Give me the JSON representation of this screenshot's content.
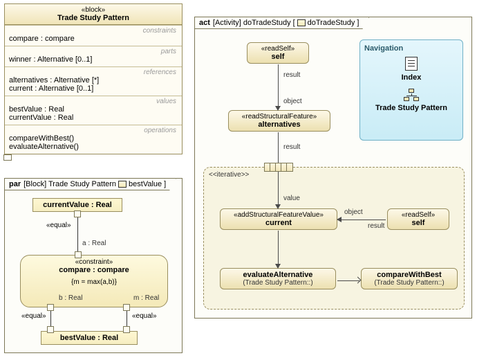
{
  "block": {
    "stereo": "«block»",
    "name": "Trade Study Pattern",
    "sections": {
      "constraints": {
        "label": "constraints",
        "items": [
          "compare : compare"
        ]
      },
      "parts": {
        "label": "parts",
        "items": [
          "winner : Alternative [0..1]"
        ]
      },
      "references": {
        "label": "references",
        "items": [
          "alternatives : Alternative [*]",
          "current : Alternative [0..1]"
        ]
      },
      "values": {
        "label": "values",
        "items": [
          "bestValue : Real",
          "currentValue : Real"
        ]
      },
      "operations": {
        "label": "operations",
        "items": [
          "compareWithBest()",
          "evaluateAlternative()"
        ]
      }
    }
  },
  "par": {
    "frame_kind": "par",
    "frame_scope": "[Block] Trade Study Pattern",
    "frame_focus": "bestValue",
    "currentValue": "currentValue : Real",
    "bestValue": "bestValue : Real",
    "constraint": {
      "stereo": "«constraint»",
      "name": "compare : compare",
      "body": "{m = max(a,b)}",
      "ports": {
        "a": "a : Real",
        "b": "b : Real",
        "m": "m : Real"
      }
    },
    "edge_label": "«equal»"
  },
  "act": {
    "frame_kind": "act",
    "frame_scope": "[Activity] doTradeStudy",
    "frame_focus": "doTradeStudy",
    "self1": {
      "stereo": "«readSelf»",
      "name": "self"
    },
    "alts": {
      "stereo": "«readStructuralFeature»",
      "name": "alternatives"
    },
    "region_label": "<<iterative>>",
    "current": {
      "stereo": "«addStructuralFeatureValue»",
      "name": "current"
    },
    "self2": {
      "stereo": "«readSelf»",
      "name": "self"
    },
    "eval": {
      "name": "evaluateAlternative",
      "sub": "(Trade Study Pattern::)"
    },
    "cmp": {
      "name": "compareWithBest",
      "sub": "(Trade Study Pattern::)"
    },
    "labels": {
      "result": "result",
      "object": "object",
      "value": "value"
    }
  },
  "nav": {
    "title": "Navigation",
    "index": "Index",
    "pattern": "Trade Study Pattern"
  }
}
